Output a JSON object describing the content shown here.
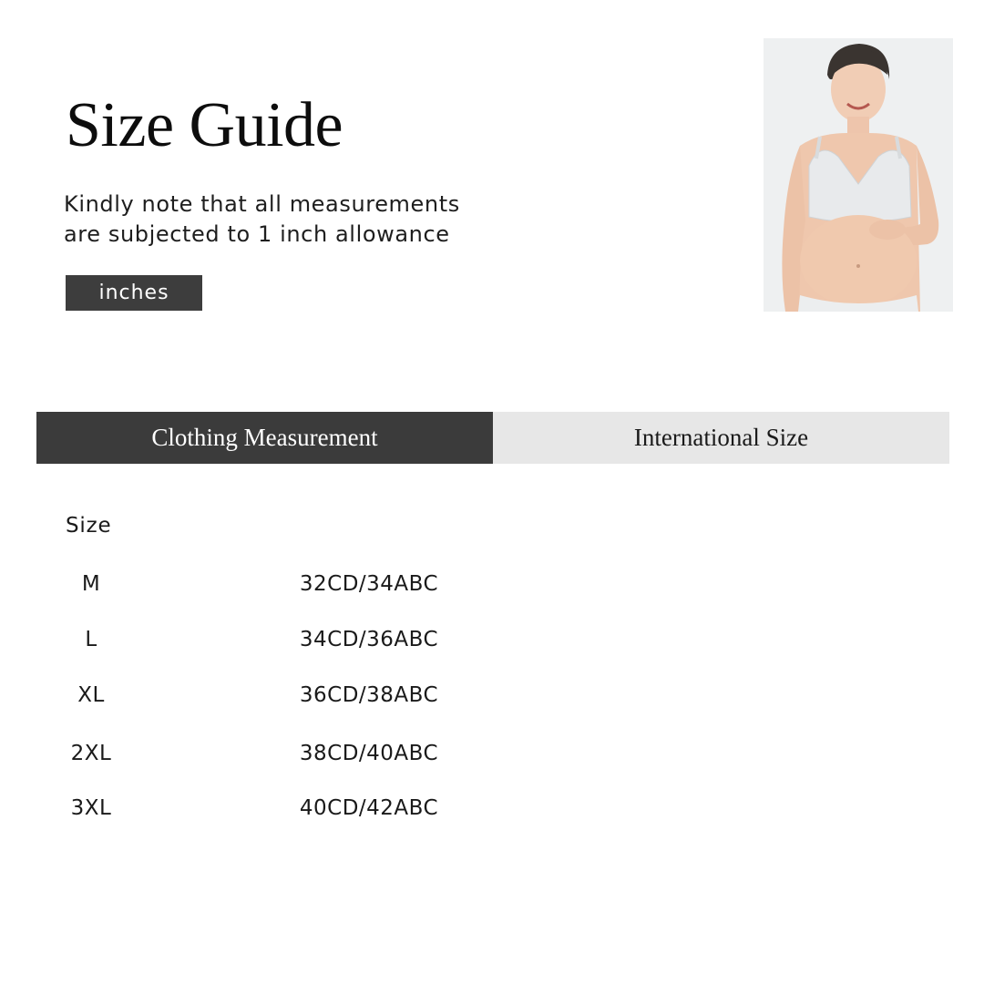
{
  "header": {
    "title": "Size Guide",
    "note_line1": "Kindly note that all measurements",
    "note_line2": "are subjected to 1 inch allowance",
    "unit_label": "inches"
  },
  "tabs": [
    {
      "label": "Clothing Measurement",
      "active": true
    },
    {
      "label": "International Size",
      "active": false
    }
  ],
  "table": {
    "column_header": "Size",
    "rows": [
      {
        "size": "M",
        "international": "32CD/34ABC"
      },
      {
        "size": "L",
        "international": "34CD/36ABC"
      },
      {
        "size": "XL",
        "international": "36CD/38ABC"
      },
      {
        "size": "2XL",
        "international": "38CD/40ABC"
      },
      {
        "size": "3XL",
        "international": "40CD/42ABC"
      }
    ]
  },
  "colors": {
    "active_tab": "#3b3b3b",
    "inactive_tab": "#e7e7e7",
    "unit_button": "#3d3d3d",
    "text": "#1a1a1a"
  },
  "image": {
    "subject": "model-photo"
  }
}
